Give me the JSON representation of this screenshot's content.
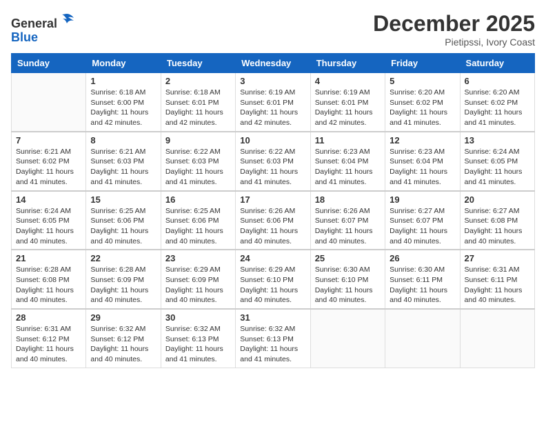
{
  "header": {
    "logo_line1": "General",
    "logo_line2": "Blue",
    "month": "December 2025",
    "location": "Pietipssi, Ivory Coast"
  },
  "weekdays": [
    "Sunday",
    "Monday",
    "Tuesday",
    "Wednesday",
    "Thursday",
    "Friday",
    "Saturday"
  ],
  "weeks": [
    [
      {
        "day": "",
        "info": ""
      },
      {
        "day": "1",
        "info": "Sunrise: 6:18 AM\nSunset: 6:00 PM\nDaylight: 11 hours\nand 42 minutes."
      },
      {
        "day": "2",
        "info": "Sunrise: 6:18 AM\nSunset: 6:01 PM\nDaylight: 11 hours\nand 42 minutes."
      },
      {
        "day": "3",
        "info": "Sunrise: 6:19 AM\nSunset: 6:01 PM\nDaylight: 11 hours\nand 42 minutes."
      },
      {
        "day": "4",
        "info": "Sunrise: 6:19 AM\nSunset: 6:01 PM\nDaylight: 11 hours\nand 42 minutes."
      },
      {
        "day": "5",
        "info": "Sunrise: 6:20 AM\nSunset: 6:02 PM\nDaylight: 11 hours\nand 41 minutes."
      },
      {
        "day": "6",
        "info": "Sunrise: 6:20 AM\nSunset: 6:02 PM\nDaylight: 11 hours\nand 41 minutes."
      }
    ],
    [
      {
        "day": "7",
        "info": "Sunrise: 6:21 AM\nSunset: 6:02 PM\nDaylight: 11 hours\nand 41 minutes."
      },
      {
        "day": "8",
        "info": "Sunrise: 6:21 AM\nSunset: 6:03 PM\nDaylight: 11 hours\nand 41 minutes."
      },
      {
        "day": "9",
        "info": "Sunrise: 6:22 AM\nSunset: 6:03 PM\nDaylight: 11 hours\nand 41 minutes."
      },
      {
        "day": "10",
        "info": "Sunrise: 6:22 AM\nSunset: 6:03 PM\nDaylight: 11 hours\nand 41 minutes."
      },
      {
        "day": "11",
        "info": "Sunrise: 6:23 AM\nSunset: 6:04 PM\nDaylight: 11 hours\nand 41 minutes."
      },
      {
        "day": "12",
        "info": "Sunrise: 6:23 AM\nSunset: 6:04 PM\nDaylight: 11 hours\nand 41 minutes."
      },
      {
        "day": "13",
        "info": "Sunrise: 6:24 AM\nSunset: 6:05 PM\nDaylight: 11 hours\nand 41 minutes."
      }
    ],
    [
      {
        "day": "14",
        "info": "Sunrise: 6:24 AM\nSunset: 6:05 PM\nDaylight: 11 hours\nand 40 minutes."
      },
      {
        "day": "15",
        "info": "Sunrise: 6:25 AM\nSunset: 6:06 PM\nDaylight: 11 hours\nand 40 minutes."
      },
      {
        "day": "16",
        "info": "Sunrise: 6:25 AM\nSunset: 6:06 PM\nDaylight: 11 hours\nand 40 minutes."
      },
      {
        "day": "17",
        "info": "Sunrise: 6:26 AM\nSunset: 6:06 PM\nDaylight: 11 hours\nand 40 minutes."
      },
      {
        "day": "18",
        "info": "Sunrise: 6:26 AM\nSunset: 6:07 PM\nDaylight: 11 hours\nand 40 minutes."
      },
      {
        "day": "19",
        "info": "Sunrise: 6:27 AM\nSunset: 6:07 PM\nDaylight: 11 hours\nand 40 minutes."
      },
      {
        "day": "20",
        "info": "Sunrise: 6:27 AM\nSunset: 6:08 PM\nDaylight: 11 hours\nand 40 minutes."
      }
    ],
    [
      {
        "day": "21",
        "info": "Sunrise: 6:28 AM\nSunset: 6:08 PM\nDaylight: 11 hours\nand 40 minutes."
      },
      {
        "day": "22",
        "info": "Sunrise: 6:28 AM\nSunset: 6:09 PM\nDaylight: 11 hours\nand 40 minutes."
      },
      {
        "day": "23",
        "info": "Sunrise: 6:29 AM\nSunset: 6:09 PM\nDaylight: 11 hours\nand 40 minutes."
      },
      {
        "day": "24",
        "info": "Sunrise: 6:29 AM\nSunset: 6:10 PM\nDaylight: 11 hours\nand 40 minutes."
      },
      {
        "day": "25",
        "info": "Sunrise: 6:30 AM\nSunset: 6:10 PM\nDaylight: 11 hours\nand 40 minutes."
      },
      {
        "day": "26",
        "info": "Sunrise: 6:30 AM\nSunset: 6:11 PM\nDaylight: 11 hours\nand 40 minutes."
      },
      {
        "day": "27",
        "info": "Sunrise: 6:31 AM\nSunset: 6:11 PM\nDaylight: 11 hours\nand 40 minutes."
      }
    ],
    [
      {
        "day": "28",
        "info": "Sunrise: 6:31 AM\nSunset: 6:12 PM\nDaylight: 11 hours\nand 40 minutes."
      },
      {
        "day": "29",
        "info": "Sunrise: 6:32 AM\nSunset: 6:12 PM\nDaylight: 11 hours\nand 40 minutes."
      },
      {
        "day": "30",
        "info": "Sunrise: 6:32 AM\nSunset: 6:13 PM\nDaylight: 11 hours\nand 41 minutes."
      },
      {
        "day": "31",
        "info": "Sunrise: 6:32 AM\nSunset: 6:13 PM\nDaylight: 11 hours\nand 41 minutes."
      },
      {
        "day": "",
        "info": ""
      },
      {
        "day": "",
        "info": ""
      },
      {
        "day": "",
        "info": ""
      }
    ]
  ]
}
